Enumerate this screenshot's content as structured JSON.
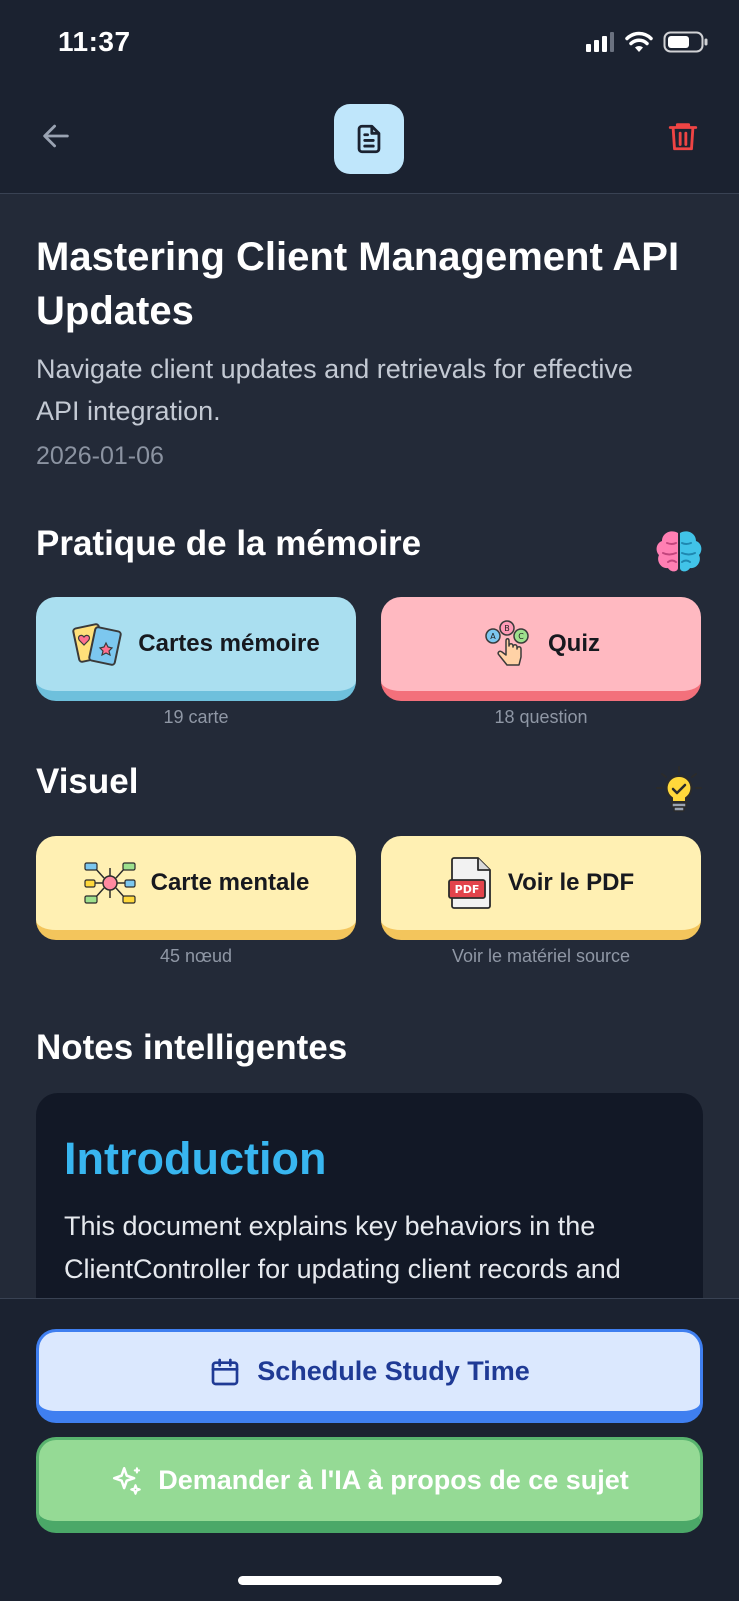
{
  "status_bar": {
    "time": "11:37",
    "signal_icon": "cellular-signal-icon",
    "wifi_icon": "wifi-icon",
    "battery_icon": "battery-icon"
  },
  "header": {
    "back_icon": "arrow-left-icon",
    "doc_icon": "document-icon",
    "delete_icon": "trash-icon"
  },
  "topic": {
    "title": "Mastering Client Management API Updates",
    "subtitle": "Navigate client updates and retrievals for effective API integration.",
    "date": "2026-01-06"
  },
  "memory_practice": {
    "title": "Pratique de la mémoire",
    "icon": "brain-icon",
    "flashcards": {
      "label": "Cartes mémoire",
      "count": "19 carte",
      "icon": "flashcards-icon",
      "color": "#aadff0"
    },
    "quiz": {
      "label": "Quiz",
      "count": "18 question",
      "icon": "quiz-choice-icon",
      "color": "#ffb9c1"
    }
  },
  "visual": {
    "title": "Visuel",
    "icon": "lightbulb-icon",
    "mindmap": {
      "label": "Carte mentale",
      "count": "45 nœud",
      "icon": "mind-map-icon",
      "color": "#fff0b3"
    },
    "pdf": {
      "label": "Voir le PDF",
      "count": "Voir le matériel source",
      "icon": "pdf-file-icon",
      "color": "#fff0b3"
    }
  },
  "smart_notes": {
    "title": "Notes intelligentes",
    "heading": "Introduction",
    "text": "This document explains key behaviors in the ClientController for updating client records and"
  },
  "actions": {
    "schedule_label": "Schedule Study Time",
    "schedule_icon": "calendar-icon",
    "ask_ai_label": "Demander à l'IA à propos de ce sujet",
    "ask_ai_icon": "sparkles-icon"
  }
}
